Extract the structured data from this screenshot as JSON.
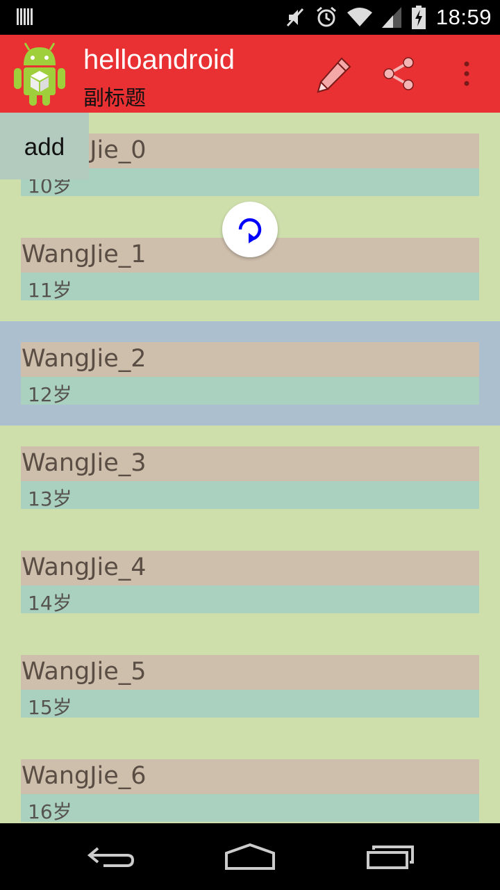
{
  "status_bar": {
    "time": "18:59",
    "icons": [
      "notification-bars-icon",
      "mute-icon",
      "alarm-icon",
      "wifi-icon",
      "signal-icon",
      "battery-charging-icon"
    ]
  },
  "action_bar": {
    "title": "helloandroid",
    "subtitle": "副标题",
    "icons": [
      "android-app-icon",
      "pencil-icon",
      "share-icon",
      "overflow-menu-icon"
    ],
    "color": "#e93032"
  },
  "add_button": {
    "label": "add"
  },
  "refresh": {
    "icon": "refresh-icon",
    "color": "#0000ff"
  },
  "list": {
    "items": [
      {
        "name": "WangJie_0",
        "age": "10岁"
      },
      {
        "name": "WangJie_1",
        "age": "11岁"
      },
      {
        "name": "WangJie_2",
        "age": "12岁"
      },
      {
        "name": "WangJie_3",
        "age": "13岁"
      },
      {
        "name": "WangJie_4",
        "age": "14岁"
      },
      {
        "name": "WangJie_5",
        "age": "15岁"
      },
      {
        "name": "WangJie_6",
        "age": "16岁"
      }
    ]
  },
  "nav_bar": {
    "icons": [
      "back-icon",
      "home-icon",
      "recents-icon"
    ]
  }
}
